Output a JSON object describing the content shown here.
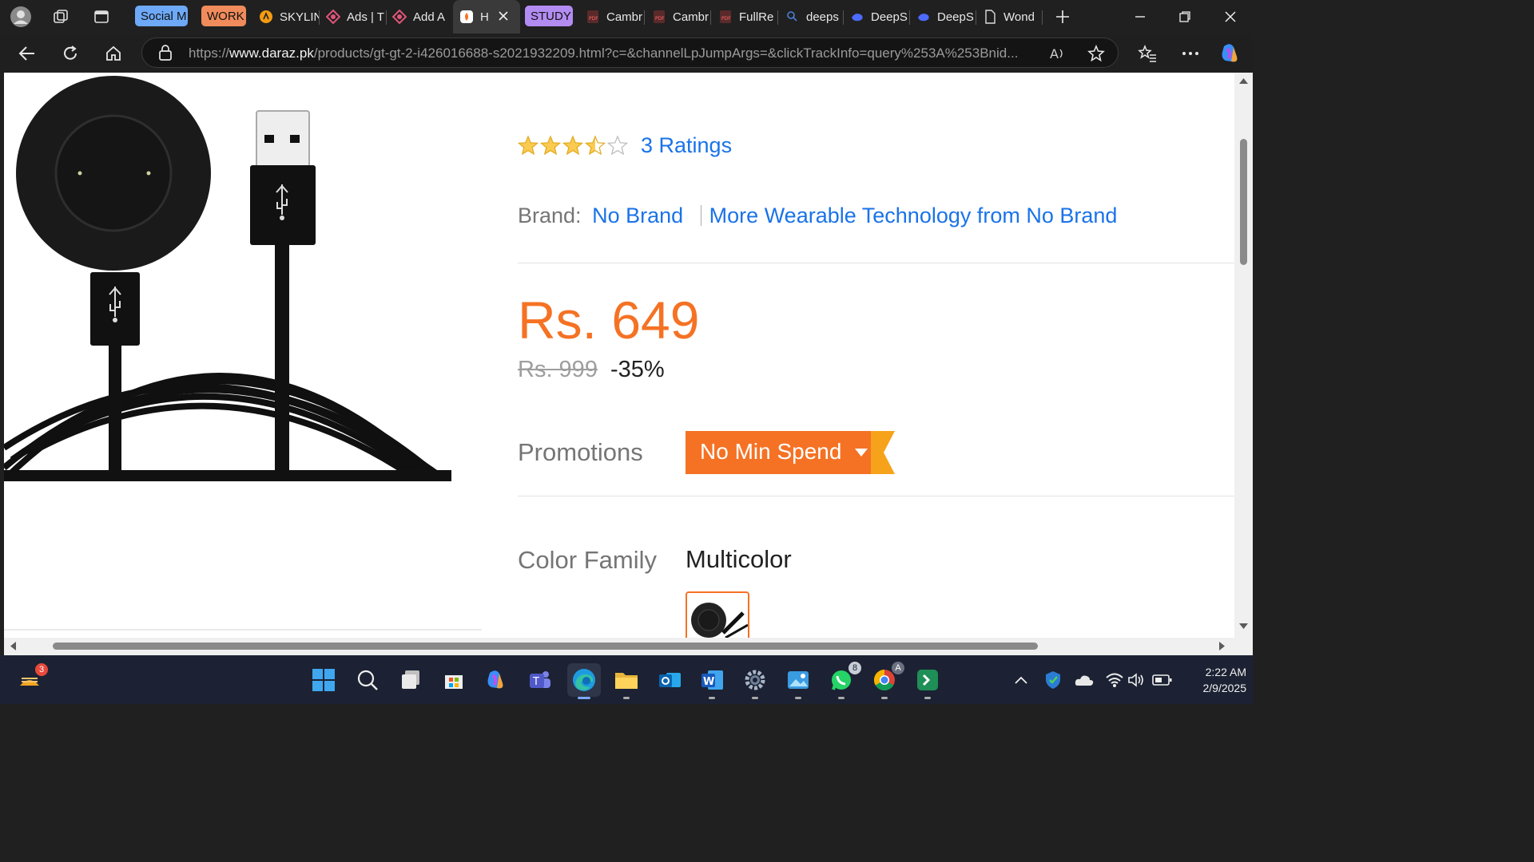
{
  "browser": {
    "tabs": [
      {
        "type": "group",
        "label": "Social M",
        "color": "#6ea9f7"
      },
      {
        "type": "group",
        "label": "WORK",
        "color": "#f08b5b"
      },
      {
        "type": "tab",
        "label": "SKYLIN",
        "icon": "orange-circle-icon"
      },
      {
        "type": "tab",
        "label": "Ads | T",
        "icon": "gem-icon"
      },
      {
        "type": "tab",
        "label": "Add A",
        "icon": "gem-icon"
      },
      {
        "type": "tab",
        "label": "H",
        "icon": "daraz-icon",
        "active": true
      },
      {
        "type": "group",
        "label": "STUDY",
        "color": "#b38cf2"
      },
      {
        "type": "tab",
        "label": "Cambr",
        "icon": "pdf-icon"
      },
      {
        "type": "tab",
        "label": "Cambr",
        "icon": "pdf-icon"
      },
      {
        "type": "tab",
        "label": "FullRe",
        "icon": "pdf-icon"
      },
      {
        "type": "tab",
        "label": "deeps",
        "icon": "search-icon"
      },
      {
        "type": "tab",
        "label": "DeepS",
        "icon": "whale-icon"
      },
      {
        "type": "tab",
        "label": "DeepS",
        "icon": "whale-icon"
      },
      {
        "type": "tab",
        "label": "Wond",
        "icon": "page-icon"
      }
    ],
    "url_prefix": "https://",
    "url_domain": "www.daraz.pk",
    "url_rest": "/products/gt-gt-2-i426016688-s2021932209.html?c=&channelLpJumpArgs=&clickTrackInfo=query%253A%253Bnid..."
  },
  "product": {
    "rating_value": 3.5,
    "ratings_text": "3 Ratings",
    "brand_label": "Brand:",
    "brand_value": "No Brand",
    "brand_more": "More Wearable Technology from No Brand",
    "price": "Rs. 649",
    "original_price": "Rs. 999",
    "discount": "-35%",
    "promotions_label": "Promotions",
    "promotion_value": "No Min Spend",
    "color_family_label": "Color Family",
    "color_family_value": "Multicolor"
  },
  "colors": {
    "accent_orange": "#f57224",
    "link_blue": "#1a73e8",
    "star_yellow": "#faca51"
  },
  "taskbar": {
    "time": "2:22 AM",
    "date": "2/9/2025",
    "widgets_badge": "3",
    "whatsapp_badge": "8",
    "chrome_badge": "A"
  }
}
